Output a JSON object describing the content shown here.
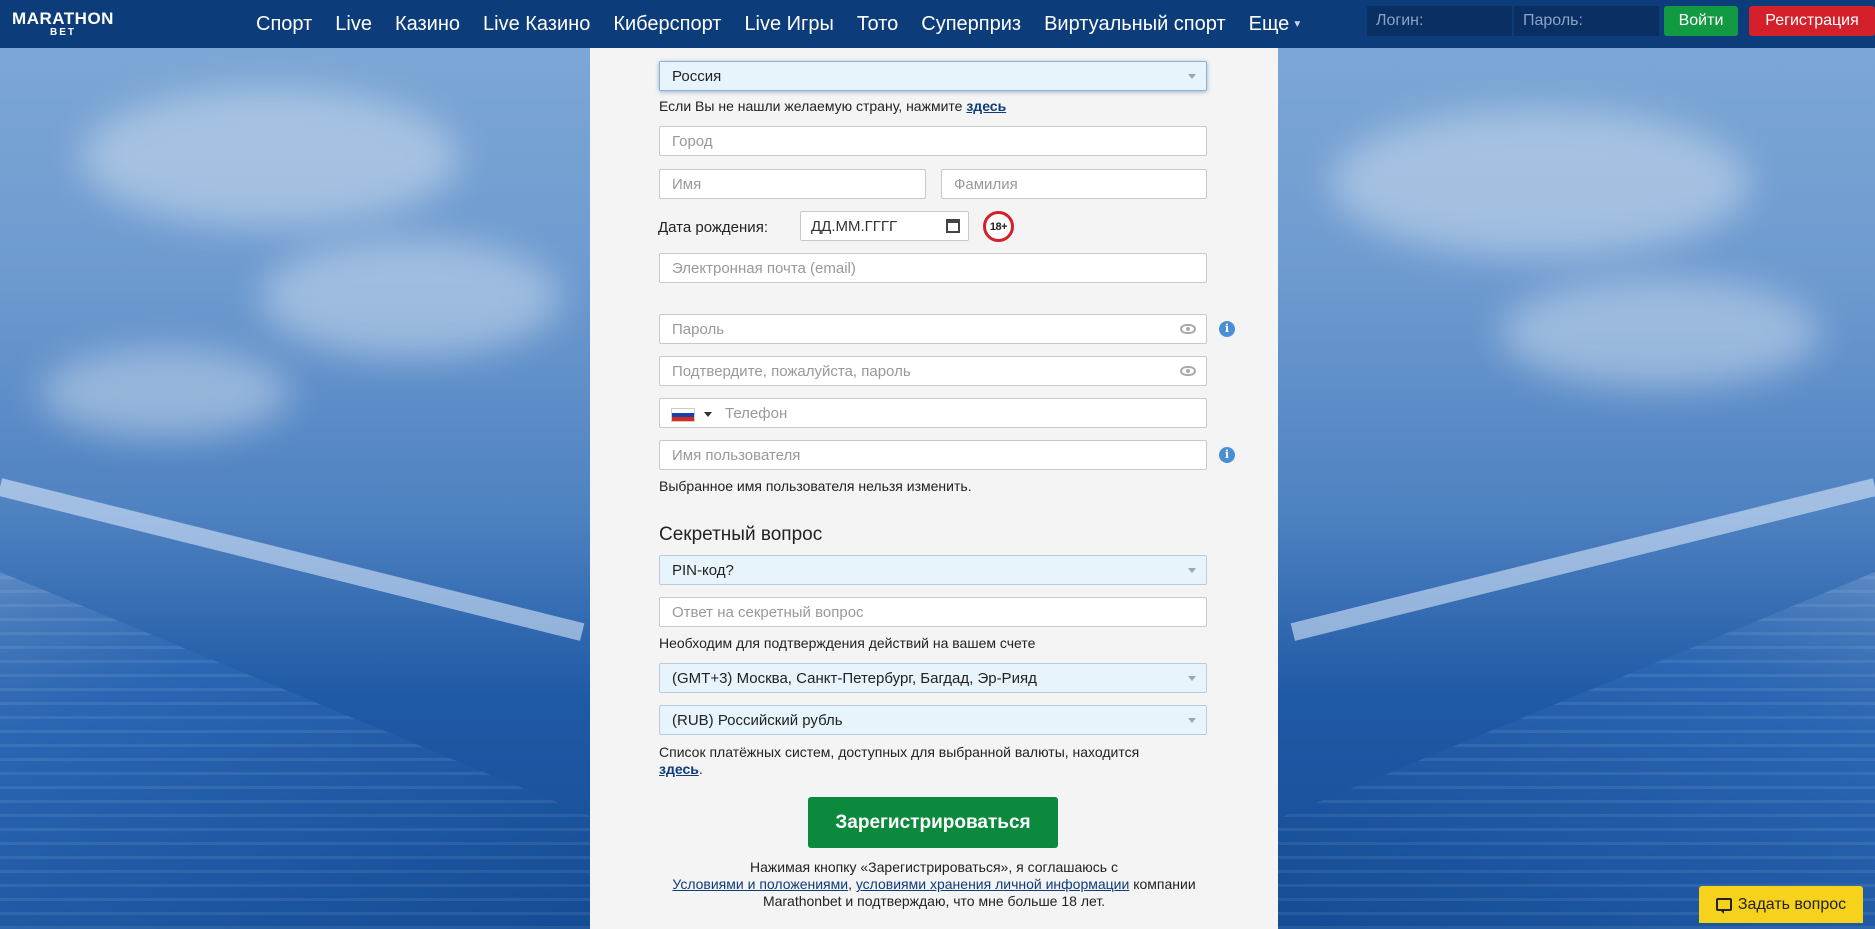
{
  "brand": {
    "logo_line1": "MARATHON",
    "logo_line2": "BET"
  },
  "nav": [
    {
      "label": "Спорт"
    },
    {
      "label": "Live"
    },
    {
      "label": "Казино"
    },
    {
      "label": "Live Казино"
    },
    {
      "label": "Киберспорт"
    },
    {
      "label": "Live Игры"
    },
    {
      "label": "Тото"
    },
    {
      "label": "Суперприз"
    },
    {
      "label": "Виртуальный спорт"
    },
    {
      "label": "Еще"
    }
  ],
  "auth": {
    "login_placeholder": "Логин:",
    "password_placeholder": "Пароль:",
    "login_button": "Войти",
    "register_button": "Регистрация"
  },
  "form": {
    "country_value": "Россия",
    "country_hint_text": "Если Вы не нашли желаемую страну, нажмите ",
    "country_hint_link": "здесь",
    "city_placeholder": "Город",
    "first_name_placeholder": "Имя",
    "last_name_placeholder": "Фамилия",
    "birth_label": "Дата рождения:",
    "birth_placeholder": "ДД.ММ.ГГГГ",
    "age_badge": "18+",
    "email_placeholder": "Электронная почта (email)",
    "password_placeholder": "Пароль",
    "password_confirm_placeholder": "Подтвердите, пожалуйста, пароль",
    "phone_placeholder": "Телефон",
    "username_placeholder": "Имя пользователя",
    "username_note": "Выбранное имя пользователя нельзя изменить.",
    "secret_heading": "Секретный вопрос",
    "secret_question_value": "PIN-код?",
    "secret_answer_placeholder": "Ответ на секретный вопрос",
    "secret_note": "Необходим для подтверждения действий на вашем счете",
    "timezone_value": "(GMT+3) Москва, Санкт-Петербург, Багдад, Эр-Рияд",
    "currency_value": "(RUB) Российский рубль",
    "payment_note_text": "Список платёжных систем, доступных для выбранной валюты, находится",
    "payment_note_link": "здесь",
    "submit_label": "Зарегистрироваться",
    "terms_line1": "Нажимая кнопку «Зарегистрироваться», я соглашаюсь с",
    "terms_link1": "Условиями и положениями",
    "terms_comma": ", ",
    "terms_link2": "условиями хранения личной информации",
    "terms_after_link2": " компании",
    "terms_line3": "Marathonbet и подтверждаю, что мне больше 18 лет."
  },
  "chat": {
    "label": "Задать вопрос"
  },
  "colors": {
    "header": "#0d3c7a",
    "login_green": "#129a43",
    "register_red": "#d3202a",
    "submit_green": "#0b8a3e",
    "chat_yellow": "#f7d21c"
  }
}
